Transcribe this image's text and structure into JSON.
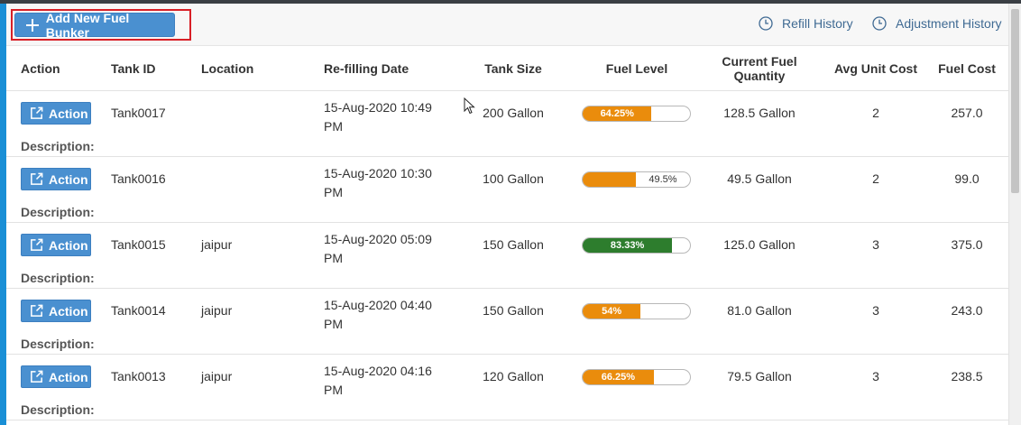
{
  "toolbar": {
    "add_button": "Add New Fuel Bunker",
    "refill_history": "Refill History",
    "adjustment_history": "Adjustment History"
  },
  "columns": {
    "action": "Action",
    "tank_id": "Tank ID",
    "location": "Location",
    "refill_date": "Re-filling Date",
    "tank_size": "Tank Size",
    "fuel_level": "Fuel Level",
    "current_qty_line1": "Current Fuel",
    "current_qty_line2": "Quantity",
    "avg_unit_cost": "Avg Unit Cost",
    "fuel_cost": "Fuel Cost"
  },
  "description_label": "Description:",
  "rows": [
    {
      "action": "Action",
      "tank_id": "Tank0017",
      "location": "",
      "date_line1": "15-Aug-2020 10:49",
      "date_line2": "PM",
      "tank_size": "200 Gallon",
      "fuel_level_label": "64.25%",
      "fuel_level": 64.25,
      "level_color": "#ea8c0c",
      "current_qty": "128.5 Gallon",
      "avg_unit_cost": "2",
      "fuel_cost": "257.0"
    },
    {
      "action": "Action",
      "tank_id": "Tank0016",
      "location": "",
      "date_line1": "15-Aug-2020 10:30",
      "date_line2": "PM",
      "tank_size": "100 Gallon",
      "fuel_level_label": "49.5%",
      "fuel_level": 49.5,
      "level_color": "#ea8c0c",
      "current_qty": "49.5 Gallon",
      "avg_unit_cost": "2",
      "fuel_cost": "99.0"
    },
    {
      "action": "Action",
      "tank_id": "Tank0015",
      "location": "jaipur",
      "date_line1": "15-Aug-2020 05:09",
      "date_line2": "PM",
      "tank_size": "150 Gallon",
      "fuel_level_label": "83.33%",
      "fuel_level": 83.33,
      "level_color": "#2d7d2d",
      "current_qty": "125.0 Gallon",
      "avg_unit_cost": "3",
      "fuel_cost": "375.0"
    },
    {
      "action": "Action",
      "tank_id": "Tank0014",
      "location": "jaipur",
      "date_line1": "15-Aug-2020 04:40",
      "date_line2": "PM",
      "tank_size": "150 Gallon",
      "fuel_level_label": "54%",
      "fuel_level": 54,
      "level_color": "#ea8c0c",
      "current_qty": "81.0 Gallon",
      "avg_unit_cost": "3",
      "fuel_cost": "243.0"
    },
    {
      "action": "Action",
      "tank_id": "Tank0013",
      "location": "jaipur",
      "date_line1": "15-Aug-2020 04:16",
      "date_line2": "PM",
      "tank_size": "120 Gallon",
      "fuel_level_label": "66.25%",
      "fuel_level": 66.25,
      "level_color": "#ea8c0c",
      "current_qty": "79.5 Gallon",
      "avg_unit_cost": "3",
      "fuel_cost": "238.5"
    }
  ],
  "colors": {
    "primary_button": "#4a90d0",
    "highlight_border": "#d81f26",
    "link": "#3f6a93"
  }
}
